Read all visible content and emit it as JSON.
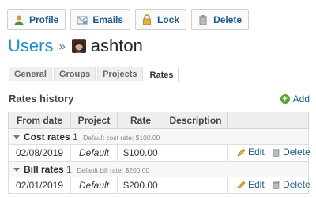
{
  "toolbar": {
    "profile_label": "Profile",
    "emails_label": "Emails",
    "lock_label": "Lock",
    "delete_label": "Delete"
  },
  "header": {
    "breadcrumb_users": "Users",
    "separator": "»",
    "username": "ashton"
  },
  "tabs": [
    {
      "label": "General",
      "active": false
    },
    {
      "label": "Groups",
      "active": false
    },
    {
      "label": "Projects",
      "active": false
    },
    {
      "label": "Rates",
      "active": true
    }
  ],
  "rates": {
    "section_title": "Rates history",
    "add_label": "Add",
    "columns": [
      "From date",
      "Project",
      "Rate",
      "Description"
    ],
    "groups": [
      {
        "name": "Cost rates",
        "count": "1",
        "default_text": "Default cost rate: $100.00",
        "rows": [
          {
            "from_date": "02/08/2019",
            "project": "Default",
            "rate": "$100.00",
            "description": "",
            "edit": "Edit",
            "delete": "Delete"
          }
        ]
      },
      {
        "name": "Bill rates",
        "count": "1",
        "default_text": "Default bill rate: $200.00",
        "rows": [
          {
            "from_date": "02/01/2019",
            "project": "Default",
            "rate": "$200.00",
            "description": "",
            "edit": "Edit",
            "delete": "Delete"
          }
        ]
      }
    ]
  },
  "colors": {
    "link": "#1d5a8a",
    "breadcrumb": "#1f8fc9",
    "add_icon": "#5aa53a"
  },
  "icons": {
    "profile": "user-icon",
    "emails": "email-icon",
    "lock": "lock-icon",
    "delete": "trash-icon",
    "add": "add-icon",
    "edit": "pencil-icon"
  }
}
